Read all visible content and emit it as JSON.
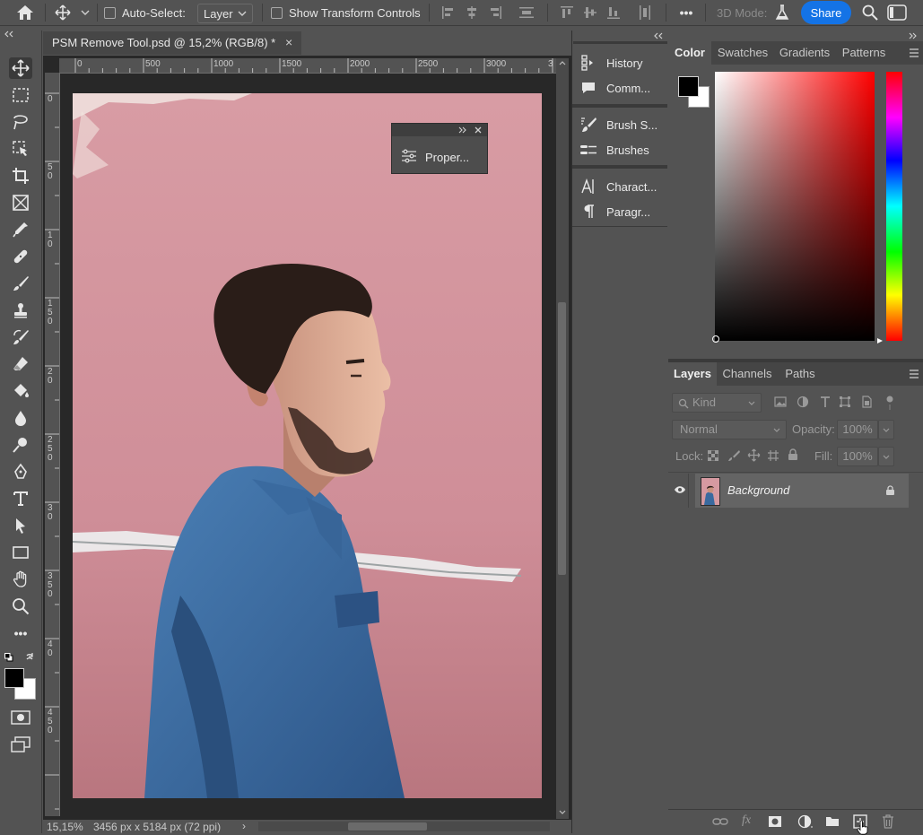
{
  "options_bar": {
    "auto_select_label": "Auto-Select:",
    "layer_select_value": "Layer",
    "show_transform_label": "Show Transform Controls",
    "mode_3d_label": "3D Mode:",
    "share_label": "Share",
    "more_glyph": "•••"
  },
  "document": {
    "tab_title": "PSM Remove Tool.psd @ 15,2% (RGB/8) *",
    "tab_close": "×",
    "ruler_h": [
      "0",
      "500",
      "1000",
      "1500",
      "2000",
      "2500",
      "3000",
      "3"
    ],
    "ruler_v": [
      "0",
      "5",
      "0",
      "1",
      "0",
      "1",
      "5",
      "0",
      "2",
      "0",
      "2",
      "5",
      "0",
      "3",
      "0",
      "3",
      "5",
      "0",
      "4",
      "0",
      "4",
      "5",
      "0"
    ],
    "zoom": "15,15%",
    "dimensions": "3456 px x 5184 px (72 ppi)",
    "status_arrow": "›"
  },
  "floating_panel": {
    "properties_label": "Proper..."
  },
  "collapsed_panels": {
    "group1": [
      {
        "label": "History",
        "icon": "history-icon"
      },
      {
        "label": "Comm...",
        "icon": "comment-icon"
      }
    ],
    "group2": [
      {
        "label": "Brush S...",
        "icon": "brush-settings-icon"
      },
      {
        "label": "Brushes",
        "icon": "brushes-icon"
      }
    ],
    "group3": [
      {
        "label": "Charact...",
        "icon": "character-icon"
      },
      {
        "label": "Paragr...",
        "icon": "paragraph-icon"
      }
    ]
  },
  "color_panel": {
    "tabs": [
      "Color",
      "Swatches",
      "Gradients",
      "Patterns"
    ],
    "foreground": "#000000",
    "background": "#ffffff",
    "hue": "#ff0000"
  },
  "layers_panel": {
    "tabs": [
      "Layers",
      "Channels",
      "Paths"
    ],
    "filter_placeholder": "Kind",
    "blend_mode": "Normal",
    "opacity_label": "Opacity:",
    "opacity_value": "100%",
    "lock_label": "Lock:",
    "fill_label": "Fill:",
    "fill_value": "100%",
    "layers": [
      {
        "name": "Background",
        "visible": true,
        "locked": true
      }
    ]
  },
  "colors": {
    "accent": "#1473e6",
    "ui_bg": "#535353",
    "canvas_wall": "#d69aa1"
  }
}
